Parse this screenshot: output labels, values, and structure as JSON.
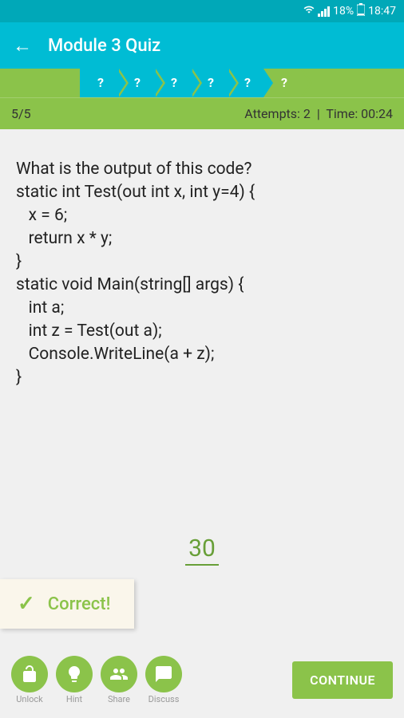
{
  "status": {
    "battery": "18%",
    "time": "18:47"
  },
  "header": {
    "title": "Module 3 Quiz"
  },
  "progress": {
    "steps": [
      "?",
      "?",
      "?",
      "?",
      "?",
      "?"
    ],
    "counter": "5/5",
    "attempts": "Attempts: 2",
    "time": "Time: 00:24"
  },
  "question": "What is the output of this code?\nstatic int Test(out int x, int y=4) {\n   x = 6;\n   return x * y;\n}\nstatic void Main(string[] args) {\n   int a;\n   int z = Test(out a);\n   Console.WriteLine(a + z);\n}",
  "answer": "30",
  "feedback": "Correct!",
  "actions": {
    "unlock": "Unlock",
    "hint": "Hint",
    "share": "Share",
    "discuss": "Discuss"
  },
  "continue": "CONTINUE"
}
